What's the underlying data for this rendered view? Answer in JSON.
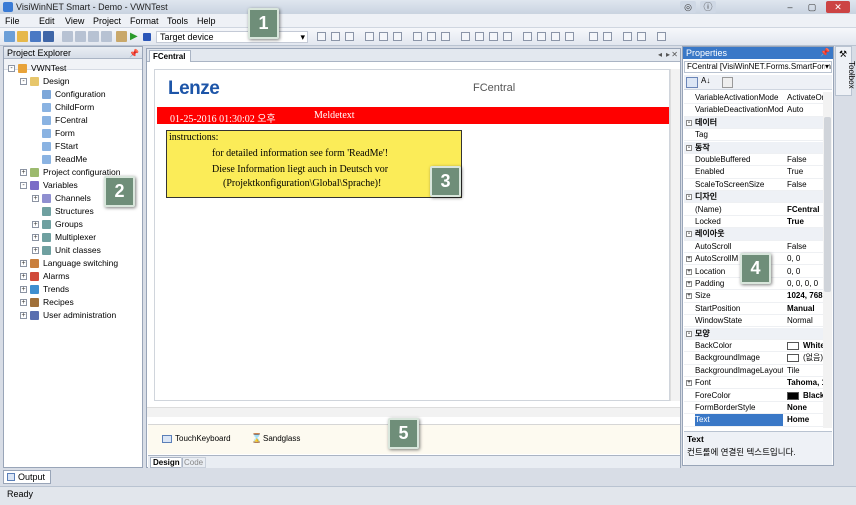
{
  "window": {
    "title": "VisiWinNET Smart - Demo - VWNTest"
  },
  "menu": [
    "File",
    "Edit",
    "View",
    "Project",
    "Format",
    "Tools",
    "Help"
  ],
  "toolbar": {
    "target_label": "Target device"
  },
  "project_explorer": {
    "title": "Project Explorer",
    "tree": [
      {
        "label": "VWNTest",
        "level": 0,
        "exp": "-"
      },
      {
        "label": "Design",
        "level": 1,
        "exp": "-"
      },
      {
        "label": "Configuration",
        "level": 2,
        "exp": ""
      },
      {
        "label": "ChildForm",
        "level": 2,
        "exp": ""
      },
      {
        "label": "FCentral",
        "level": 2,
        "exp": ""
      },
      {
        "label": "Form",
        "level": 2,
        "exp": ""
      },
      {
        "label": "FStart",
        "level": 2,
        "exp": ""
      },
      {
        "label": "ReadMe",
        "level": 2,
        "exp": ""
      },
      {
        "label": "Project configuration",
        "level": 1,
        "exp": "+"
      },
      {
        "label": "Variables",
        "level": 1,
        "exp": "-"
      },
      {
        "label": "Channels",
        "level": 2,
        "exp": "+"
      },
      {
        "label": "Structures",
        "level": 2,
        "exp": ""
      },
      {
        "label": "Groups",
        "level": 2,
        "exp": "+"
      },
      {
        "label": "Multiplexer",
        "level": 2,
        "exp": "+"
      },
      {
        "label": "Unit classes",
        "level": 2,
        "exp": "+"
      },
      {
        "label": "Language switching",
        "level": 1,
        "exp": "+"
      },
      {
        "label": "Alarms",
        "level": 1,
        "exp": "+"
      },
      {
        "label": "Trends",
        "level": 1,
        "exp": "+"
      },
      {
        "label": "Recipes",
        "level": 1,
        "exp": "+"
      },
      {
        "label": "User administration",
        "level": 1,
        "exp": "+"
      }
    ]
  },
  "document": {
    "tab": "FCentral",
    "logo": "Lenze",
    "form_name": "FCentral",
    "datetime": "01-25-2016 01:30:02 오후",
    "message": "Meldetext",
    "instructions": [
      "instructions:",
      "for detailed information see form 'ReadMe'!",
      "Diese Information liegt auch in Deutsch vor",
      "(Projektkonfiguration\\Global\\Sprache)!"
    ],
    "tray": [
      "TouchKeyboard",
      "Sandglass"
    ],
    "view_tabs": [
      "Design",
      "Code"
    ]
  },
  "properties": {
    "title": "Properties",
    "object": "FCentral [VisiWinNET.Forms.SmartForm",
    "rows": [
      {
        "name": "VariableActivationMode",
        "value": "ActivateOn",
        "kind": "prop"
      },
      {
        "name": "VariableDeactivationMod",
        "value": "Auto",
        "kind": "prop"
      },
      {
        "name": "데이터",
        "value": "",
        "kind": "cat"
      },
      {
        "name": "Tag",
        "value": "",
        "kind": "prop"
      },
      {
        "name": "동작",
        "value": "",
        "kind": "cat"
      },
      {
        "name": "DoubleBuffered",
        "value": "False",
        "kind": "prop"
      },
      {
        "name": "Enabled",
        "value": "True",
        "kind": "prop"
      },
      {
        "name": "ScaleToScreenSize",
        "value": "False",
        "kind": "prop"
      },
      {
        "name": "디자인",
        "value": "",
        "kind": "cat"
      },
      {
        "name": "(Name)",
        "value": "FCentral",
        "kind": "bold"
      },
      {
        "name": "Locked",
        "value": "True",
        "kind": "bold"
      },
      {
        "name": "레이아웃",
        "value": "",
        "kind": "cat"
      },
      {
        "name": "AutoScroll",
        "value": "False",
        "kind": "prop"
      },
      {
        "name": "AutoScrollM",
        "value": "0, 0",
        "kind": "exp"
      },
      {
        "name": "Location",
        "value": "0, 0",
        "kind": "exp"
      },
      {
        "name": "Padding",
        "value": "0, 0, 0, 0",
        "kind": "exp"
      },
      {
        "name": "Size",
        "value": "1024, 768",
        "kind": "expbold"
      },
      {
        "name": "StartPosition",
        "value": "Manual",
        "kind": "bold"
      },
      {
        "name": "WindowState",
        "value": "Normal",
        "kind": "prop"
      },
      {
        "name": "모양",
        "value": "",
        "kind": "cat"
      },
      {
        "name": "BackColor",
        "value": "White",
        "kind": "swatch",
        "color": "#ffffff"
      },
      {
        "name": "BackgroundImage",
        "value": "(없음)",
        "kind": "swatch",
        "color": "#ffffff"
      },
      {
        "name": "BackgroundImageLayout",
        "value": "Tile",
        "kind": "prop"
      },
      {
        "name": "Font",
        "value": "Tahoma, 1",
        "kind": "expbold"
      },
      {
        "name": "ForeColor",
        "value": "Black",
        "kind": "swatch",
        "color": "#000000"
      },
      {
        "name": "FormBorderStyle",
        "value": "None",
        "kind": "bold"
      },
      {
        "name": "Text",
        "value": "Home",
        "kind": "selbold"
      }
    ],
    "desc_title": "Text",
    "desc_text": "컨트롤에 연결된 텍스트입니다."
  },
  "toolbox_label": "Toolbox",
  "output_tab": "Output",
  "status": "Ready",
  "badges": [
    "1",
    "2",
    "3",
    "4",
    "5"
  ]
}
